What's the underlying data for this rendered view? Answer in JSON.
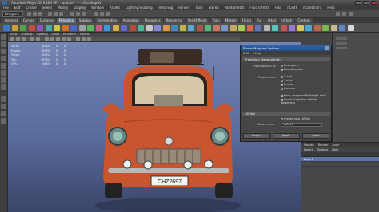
{
  "window": {
    "title": "Autodesk Maya 2013 x64 SP1 - untitled* --- pCarShape1",
    "controls": [
      "minimize",
      "maximize",
      "close"
    ]
  },
  "menubar": {
    "items": [
      "File",
      "Edit",
      "Create",
      "Select",
      "Modify",
      "Display",
      "Window",
      "Assets",
      "Lighting/Shading",
      "Texturing",
      "Render",
      "Toon",
      "Stereo",
      "Paint Effects",
      "Fluid Effects",
      "Hair",
      "nCloth",
      "nConstraint",
      "Help"
    ]
  },
  "statusline": {
    "mode": "Polygons"
  },
  "shelf": {
    "tabs": [
      "General",
      "Curves",
      "Surfaces",
      "Polygons",
      "Subdivs",
      "Deformation",
      "Animation",
      "Dynamics",
      "Rendering",
      "PaintEffects",
      "Toon",
      "Muscle",
      "Fluids",
      "Fur",
      "nHair",
      "nCloth",
      "Custom"
    ],
    "active_tab": "Polygons",
    "icon_colors": [
      "#3c78c8",
      "#c8a038",
      "#58a048",
      "#c84848",
      "#8a58b8",
      "#48a8a8",
      "#c8c848",
      "#d07030",
      "#4868c8",
      "#a0a0a0",
      "#58b858",
      "#c85888",
      "#3898d8",
      "#d8b048",
      "#6868c8",
      "#b84838",
      "#48b898",
      "#c8c8c8",
      "#8888d8",
      "#d89848",
      "#4888b8",
      "#b8b848",
      "#58a8d8",
      "#a85848",
      "#58b878",
      "#c87858",
      "#7898c8",
      "#c8a858",
      "#a8c858",
      "#d86848",
      "#5878b8",
      "#b8b8b8",
      "#58c8b8",
      "#c85858",
      "#9878d8",
      "#d8c858",
      "#48a8d8",
      "#b86848",
      "#78b848",
      "#c8b898",
      "#5888c8",
      "#d8d8d8"
    ]
  },
  "viewport": {
    "menu": [
      "View",
      "Shading",
      "Lighting",
      "Show",
      "Renderer",
      "Panels"
    ],
    "background_top": "#7384b4",
    "background_bottom": "#3a4568"
  },
  "hud": {
    "rows": [
      {
        "label": "Verts:",
        "value": "8384",
        "sel": "0",
        "extra": "0"
      },
      {
        "label": "Edges:",
        "value": "16560",
        "sel": "0",
        "extra": "0"
      },
      {
        "label": "Faces:",
        "value": "8192",
        "sel": "0",
        "extra": "0"
      },
      {
        "label": "Tris:",
        "value": "16384",
        "sel": "0",
        "extra": "0"
      },
      {
        "label": "UVs:",
        "value": "9283",
        "sel": "0",
        "extra": "0"
      }
    ]
  },
  "car": {
    "body_color": "#c8552e",
    "license_plate": "CHZ2697"
  },
  "panel": {
    "title": "Planar Mapping Options",
    "menu": [
      "Edit",
      "Help"
    ],
    "section_projection": "Projection Manipulation",
    "fit_label": "Fit projection to:",
    "fit_options": [
      {
        "label": "Best plane",
        "on": false
      },
      {
        "label": "Bounding box",
        "on": true
      }
    ],
    "from_label": "Project from:",
    "from_options": [
      {
        "label": "X axis",
        "on": false
      },
      {
        "label": "Y axis",
        "on": false
      },
      {
        "label": "Z axis",
        "on": true
      },
      {
        "label": "Camera",
        "on": false
      }
    ],
    "checks": [
      {
        "label": "Keep image width/height ratio",
        "on": false
      },
      {
        "label": "Insert projection before deformers",
        "on": true
      }
    ],
    "section_uv": "UV Set",
    "uv_check": "Create new UV Set",
    "uv_set_label": "UV set name",
    "uv_set_value": "uvSet1",
    "buttons": [
      "Project",
      "Apply",
      "Close"
    ]
  },
  "layers": {
    "tabs": [
      "Display",
      "Render",
      "Anim"
    ],
    "menu": [
      "Layers",
      "Options",
      "Help"
    ],
    "rows": [
      {
        "label": "Layer1",
        "selected": true
      },
      {
        "label": "",
        "selected": false
      },
      {
        "label": "",
        "selected": false
      }
    ]
  }
}
